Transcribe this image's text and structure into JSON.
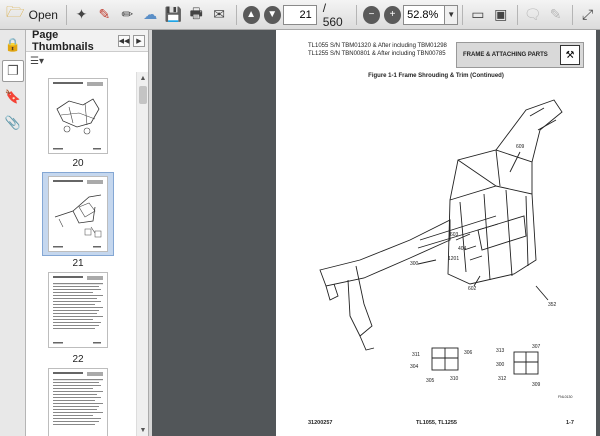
{
  "toolbar": {
    "open_label": "Open",
    "current_page": "21",
    "page_total": "/ 560",
    "zoom": "52.8%"
  },
  "panel": {
    "title": "Page Thumbnails",
    "thumbnails": [
      {
        "label": "20"
      },
      {
        "label": "21"
      },
      {
        "label": "22"
      }
    ]
  },
  "document": {
    "header_line1": "TL1055 S/N TBM01320 & After including TBM01298",
    "header_line2": "TL1255 S/N TBN00801 & After including TBN00785",
    "section_title": "FRAME & ATTACHING PARTS",
    "figure_caption": "Figure 1-1 Frame Shrouding & Trim (Continued)",
    "callouts": [
      "300",
      "609",
      "603",
      "404",
      "1201",
      "602",
      "352",
      "311",
      "306",
      "304",
      "305",
      "310",
      "313",
      "307",
      "300",
      "312",
      "309",
      "FNL0130"
    ],
    "footer_left": "31200257",
    "footer_center": "TL1055, TL1255",
    "footer_right": "1-7"
  }
}
